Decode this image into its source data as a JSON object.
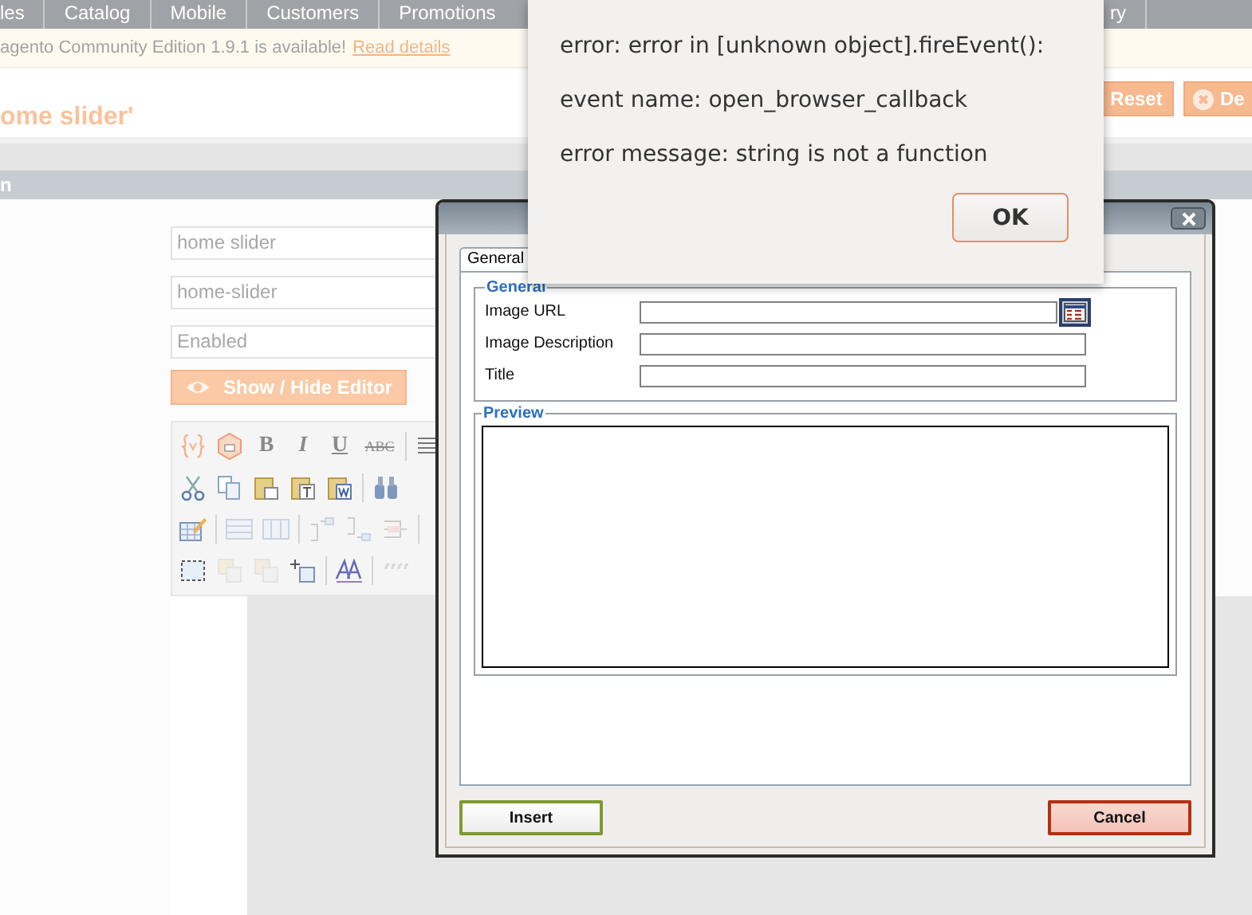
{
  "nav": {
    "items": [
      {
        "label": "les"
      },
      {
        "label": "Catalog"
      },
      {
        "label": "Mobile"
      },
      {
        "label": "Customers"
      },
      {
        "label": "Promotions"
      }
    ],
    "trailing_item": "ry"
  },
  "notice": {
    "text": "agento Community Edition 1.9.1 is available!",
    "link": "Read details"
  },
  "page_title": "ome slider'",
  "header_buttons": [
    {
      "label": "Reset",
      "kind": "plain"
    },
    {
      "label": "De",
      "kind": "delete"
    }
  ],
  "section_header": "n",
  "form": {
    "title_value": "home slider",
    "identifier_value": "home-slider",
    "status_value": "Enabled",
    "editor_button": "Show / Hide Editor"
  },
  "editor_toolbar": {
    "bold": "B",
    "italic": "I",
    "underline": "U",
    "strikethrough": "ABC"
  },
  "image_dialog": {
    "tabs": [
      {
        "label": "General",
        "selected": true
      }
    ],
    "general_legend": "General",
    "fields": [
      {
        "label": "Image URL",
        "kind": "browse"
      },
      {
        "label": "Image Description",
        "kind": "plain"
      },
      {
        "label": "Title",
        "kind": "plain"
      }
    ],
    "preview_legend": "Preview",
    "buttons": [
      {
        "label": "Insert",
        "kind": "insert"
      },
      {
        "label": "Cancel",
        "kind": "cancel"
      }
    ]
  },
  "alert": {
    "lines": [
      "error: error in [unknown object].fireEvent():",
      "event name: open_browser_callback",
      "error message: string is not a function"
    ],
    "button": "OK"
  }
}
